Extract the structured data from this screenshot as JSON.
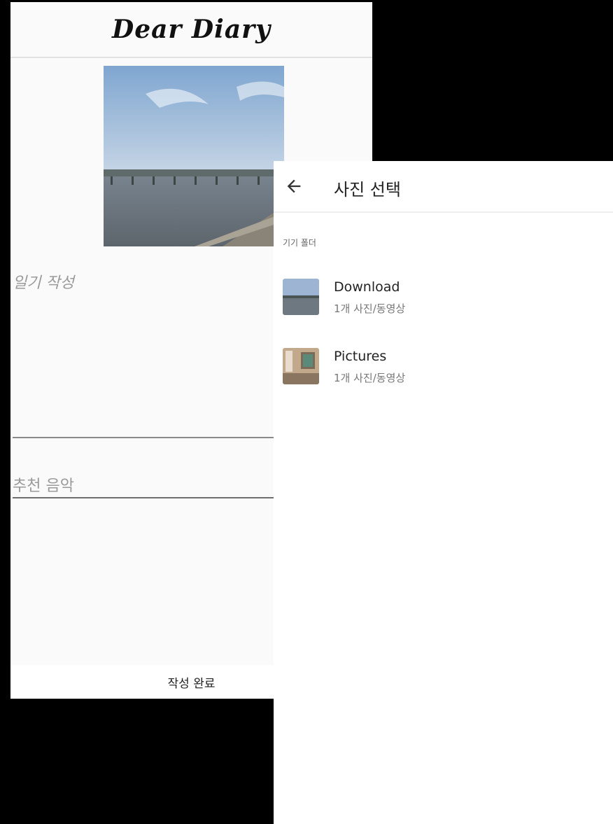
{
  "diary": {
    "title": "Dear Diary",
    "diary_placeholder": "일기 작성",
    "music_placeholder": "추천 음악",
    "submit_label": "작성 완료"
  },
  "picker": {
    "title": "사진 선택",
    "section_label": "기기 폴더",
    "folders": [
      {
        "name": "Download",
        "count": "1개 사진/동영상"
      },
      {
        "name": "Pictures",
        "count": "1개 사진/동영상"
      }
    ]
  }
}
